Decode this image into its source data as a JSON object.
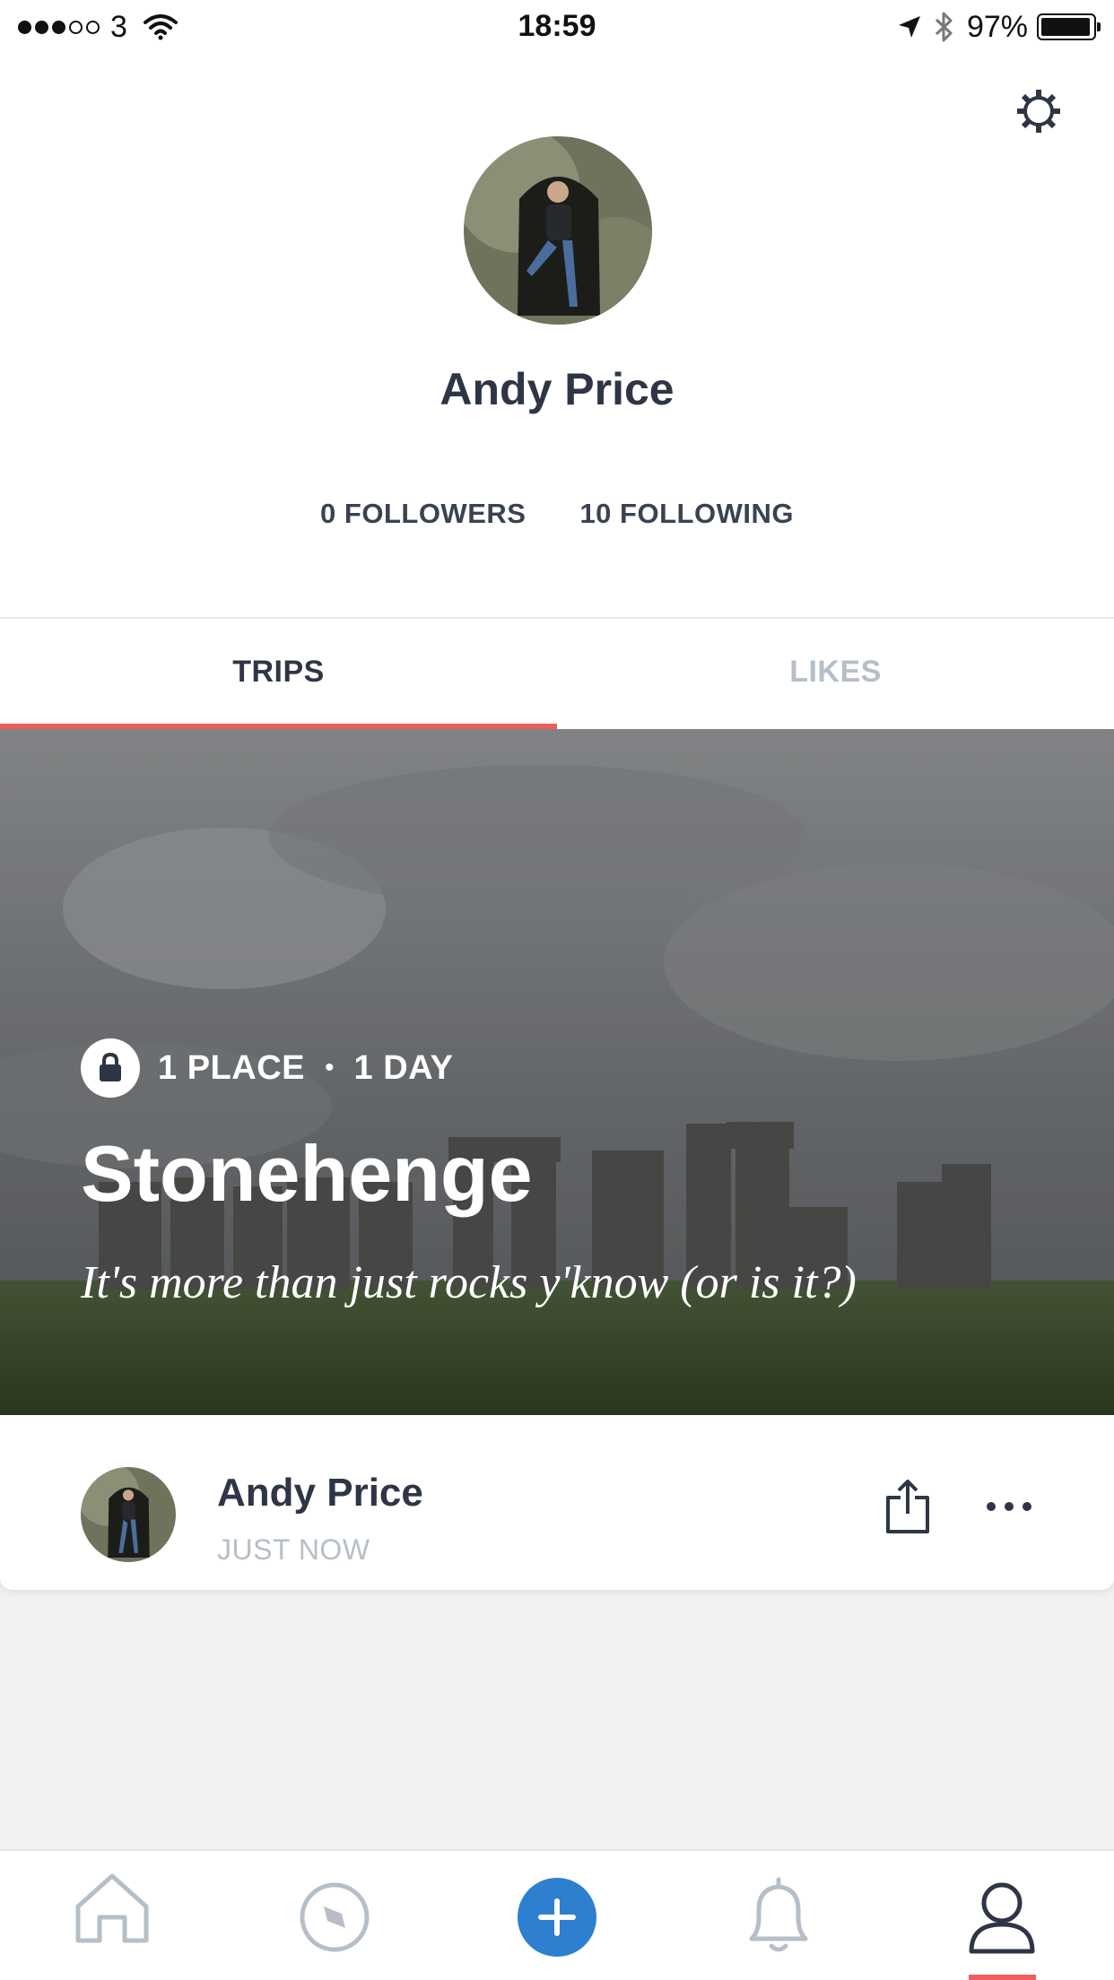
{
  "status_bar": {
    "carrier": "3",
    "time": "18:59",
    "battery_percent": "97%",
    "battery_level": 0.97,
    "signal_bars_filled": 3,
    "signal_bars_total": 5
  },
  "profile": {
    "name": "Andy Price",
    "followers": "0 FOLLOWERS",
    "following": "10 FOLLOWING"
  },
  "tabs": [
    {
      "label": "TRIPS",
      "active": true
    },
    {
      "label": "LIKES",
      "active": false
    }
  ],
  "trip": {
    "places": "1 PLACE",
    "separator": "•",
    "duration": "1 DAY",
    "title": "Stonehenge",
    "description": "It's more than just rocks y'know (or is it?)",
    "author": "Andy Price",
    "timestamp": "JUST NOW",
    "privacy_icon": "lock-icon"
  },
  "nav": {
    "items": [
      "home-icon",
      "explore-compass-icon",
      "add-icon",
      "bell-icon",
      "profile-icon"
    ],
    "active": "profile-icon"
  },
  "colors": {
    "accent": "#ef5d5d",
    "brand_blue": "#2e7fd0",
    "text_dark": "#2e3646",
    "text_muted": "#b6bfc8"
  }
}
